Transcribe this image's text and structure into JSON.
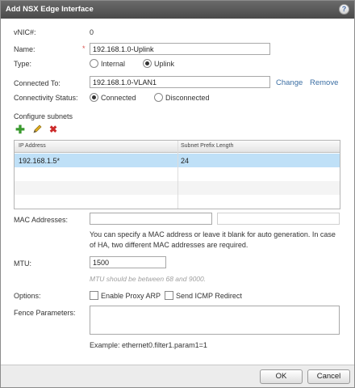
{
  "dialog": {
    "title": "Add NSX Edge Interface",
    "help_glyph": "?"
  },
  "form": {
    "vnic_label": "vNIC#:",
    "vnic_value": "0",
    "name_label": "Name:",
    "name_required_mark": "*",
    "name_value": "192.168.1.0-Uplink",
    "type_label": "Type:",
    "type_options": [
      "Internal",
      "Uplink"
    ],
    "type_selected": "Uplink",
    "connected_to_label": "Connected To:",
    "connected_to_value": "192.168.1.0-VLAN1",
    "change_link": "Change",
    "remove_link": "Remove",
    "connectivity_label": "Connectivity Status:",
    "connectivity_options": [
      "Connected",
      "Disconnected"
    ],
    "connectivity_selected": "Connected",
    "subnets_heading": "Configure subnets"
  },
  "subnets": {
    "columns": [
      "IP Address",
      "Subnet Prefix Length"
    ],
    "rows": [
      {
        "ip": "192.168.1.5*",
        "prefix": "24",
        "selected": true
      }
    ]
  },
  "mac": {
    "label": "MAC Addresses:",
    "value1": "",
    "value2": "",
    "help_text": "You can specify a MAC address or leave it blank for auto generation. In case of HA, two different MAC addresses are required."
  },
  "mtu": {
    "label": "MTU:",
    "value": "1500",
    "hint": "MTU should be between 68 and 9000."
  },
  "options": {
    "label": "Options:",
    "proxy_arp": "Enable Proxy ARP",
    "proxy_arp_checked": false,
    "icmp_redirect": "Send ICMP Redirect",
    "icmp_redirect_checked": false
  },
  "fence": {
    "label": "Fence Parameters:",
    "value": "",
    "example": "Example: ethernet0.filter1.param1=1"
  },
  "buttons": {
    "ok": "OK",
    "cancel": "Cancel"
  },
  "colors": {
    "title_bar": "#555555",
    "link": "#3b6ea3",
    "selection": "#bfe0f7",
    "add_icon": "#3a9a2e",
    "edit_icon": "#d8a21a",
    "delete_icon": "#cc2a2a"
  }
}
